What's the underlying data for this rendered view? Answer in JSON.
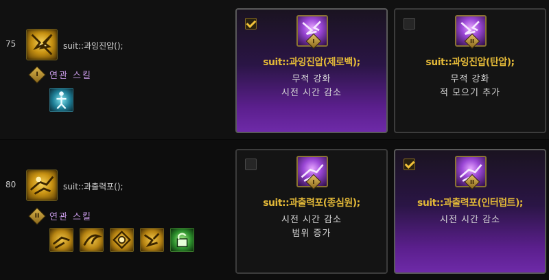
{
  "rows": [
    {
      "level": "75",
      "skill_name": "suit::과잉진압();",
      "related_roman": "I",
      "related_label": "연관 스킬",
      "related_icons": [
        "teal-figure-skill-icon"
      ],
      "options": [
        {
          "checked": true,
          "roman": "I",
          "title": "suit::과잉진압(제로백);",
          "lines": [
            "무적 강화",
            "시전 시간 감소"
          ]
        },
        {
          "checked": false,
          "roman": "II",
          "title": "suit::과잉진압(탄압);",
          "lines": [
            "무적 강화",
            "적 모으기 추가"
          ]
        }
      ]
    },
    {
      "level": "80",
      "skill_name": "suit::과출력포();",
      "related_roman": "II",
      "related_label": "연관 스킬",
      "related_icons": [
        "gold-dash-skill-icon",
        "gold-swirl-skill-icon",
        "gold-rune-skill-icon",
        "gold-figure-skill-icon",
        "green-lock-skill-icon"
      ],
      "options": [
        {
          "checked": false,
          "roman": "I",
          "title": "suit::과출력포(종심원);",
          "lines": [
            "시전 시간 감소",
            "범위 증가"
          ]
        },
        {
          "checked": true,
          "roman": "II",
          "title": "suit::과출력포(인터럽트);",
          "lines": [
            "시전 시간 감소"
          ]
        }
      ]
    }
  ]
}
